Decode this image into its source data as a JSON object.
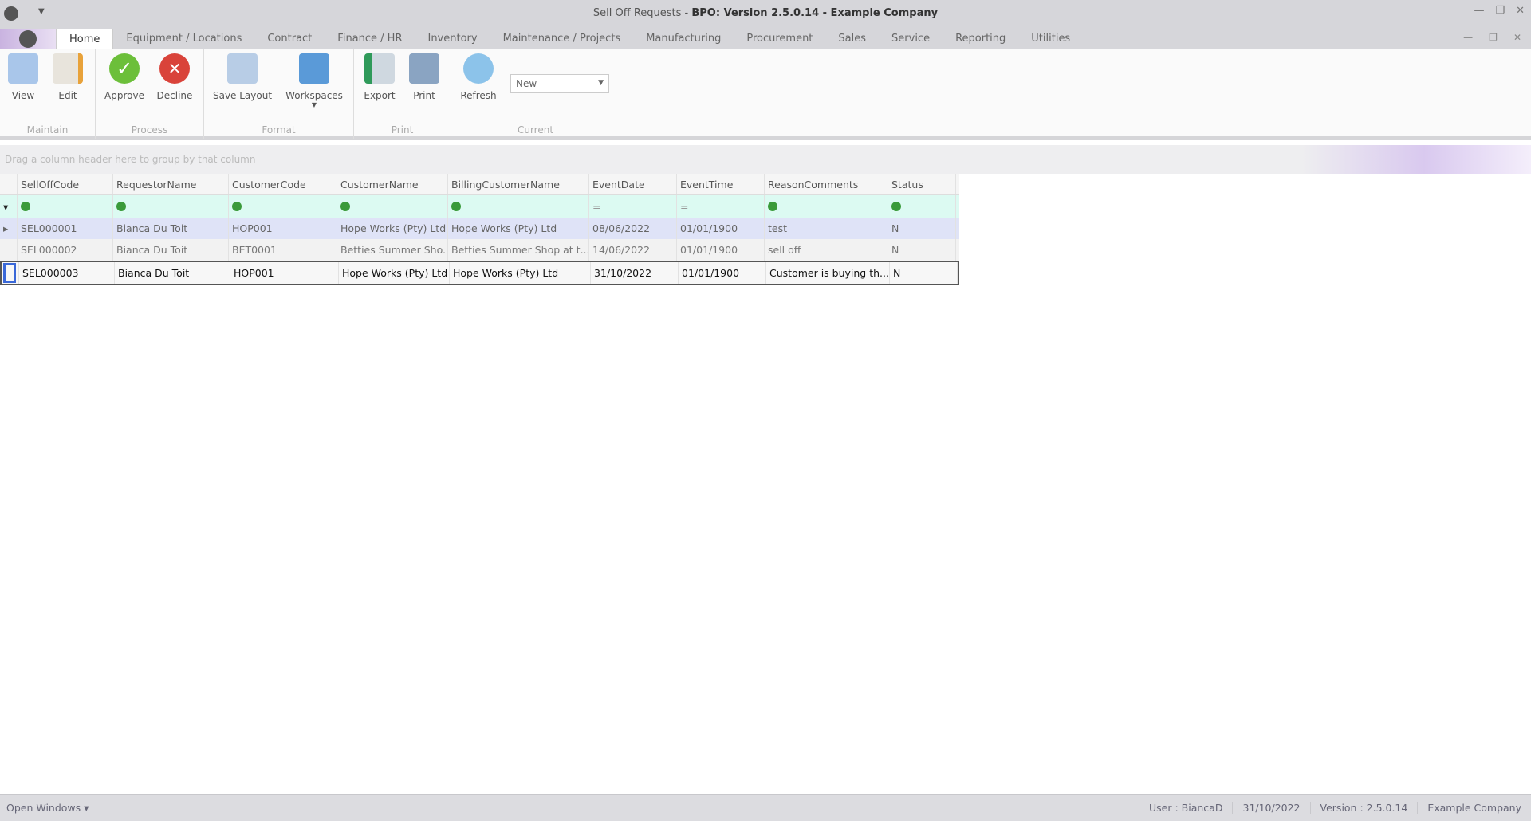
{
  "window": {
    "title_prefix": "Sell Off Requests - ",
    "title_bold": "BPO: Version 2.5.0.14 - Example Company"
  },
  "tabs": [
    "Home",
    "Equipment / Locations",
    "Contract",
    "Finance / HR",
    "Inventory",
    "Maintenance / Projects",
    "Manufacturing",
    "Procurement",
    "Sales",
    "Service",
    "Reporting",
    "Utilities"
  ],
  "ribbon": {
    "maintain": {
      "label": "Maintain",
      "view": "View",
      "edit": "Edit"
    },
    "process": {
      "label": "Process",
      "approve": "Approve",
      "decline": "Decline"
    },
    "format": {
      "label": "Format",
      "save_layout": "Save Layout",
      "workspaces": "Workspaces"
    },
    "print": {
      "label": "Print",
      "export": "Export",
      "print": "Print"
    },
    "current": {
      "label": "Current",
      "refresh": "Refresh",
      "combo_value": "New"
    }
  },
  "grid": {
    "group_hint": "Drag a column header here to group by that column",
    "columns": [
      "SellOffCode",
      "RequestorName",
      "CustomerCode",
      "CustomerName",
      "BillingCustomerName",
      "EventDate",
      "EventTime",
      "ReasonComments",
      "Status"
    ],
    "rows": [
      [
        "SEL000001",
        "Bianca Du Toit",
        "HOP001",
        "Hope Works (Pty) Ltd",
        "Hope Works (Pty) Ltd",
        "08/06/2022",
        "01/01/1900",
        "test",
        "N"
      ],
      [
        "SEL000002",
        "Bianca Du Toit",
        "BET0001",
        "Betties Summer Sho...",
        "Betties Summer Shop at t...",
        "14/06/2022",
        "01/01/1900",
        "sell off",
        "N"
      ],
      [
        "SEL000003",
        "Bianca Du Toit",
        "HOP001",
        "Hope Works (Pty) Ltd",
        "Hope Works (Pty) Ltd",
        "31/10/2022",
        "01/01/1900",
        "Customer is buying th...",
        "N"
      ]
    ]
  },
  "statusbar": {
    "open_windows": "Open Windows ▾",
    "user": "User : BiancaD",
    "date": "31/10/2022",
    "version": "Version : 2.5.0.14",
    "company": "Example Company"
  }
}
